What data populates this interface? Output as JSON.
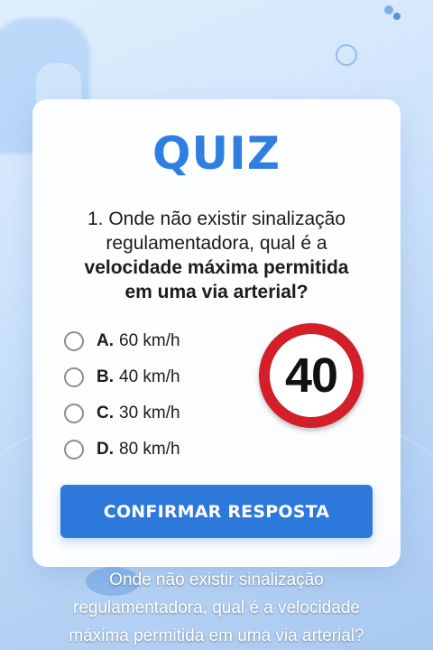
{
  "quiz": {
    "title": "QUIZ",
    "question": {
      "number_line": "1. Onde não existir sinalização",
      "line_2": "regulamentadora, qual é a",
      "bold_line_1": "velocidade máxima permitida",
      "bold_line_2": "em uma via arterial?"
    },
    "options": [
      {
        "letter": "A.",
        "text": "60 km/h"
      },
      {
        "letter": "B.",
        "text": "40 km/h"
      },
      {
        "letter": "C.",
        "text": "30 km/h"
      },
      {
        "letter": "D.",
        "text": "80 km/h"
      }
    ],
    "speed_sign": {
      "value": "40",
      "icon": "speed-limit-sign"
    },
    "confirm_label": "CONFIRMAR RESPOSTA"
  },
  "caption": {
    "line_1": "Onde não existir sinalização",
    "line_2": "regulamentadora, qual é a velocidade",
    "line_3": "máxima permitida em uma via arterial?"
  },
  "colors": {
    "accent": "#2f7fe0",
    "button": "#2d78db",
    "sign_red": "#d31f2a"
  }
}
